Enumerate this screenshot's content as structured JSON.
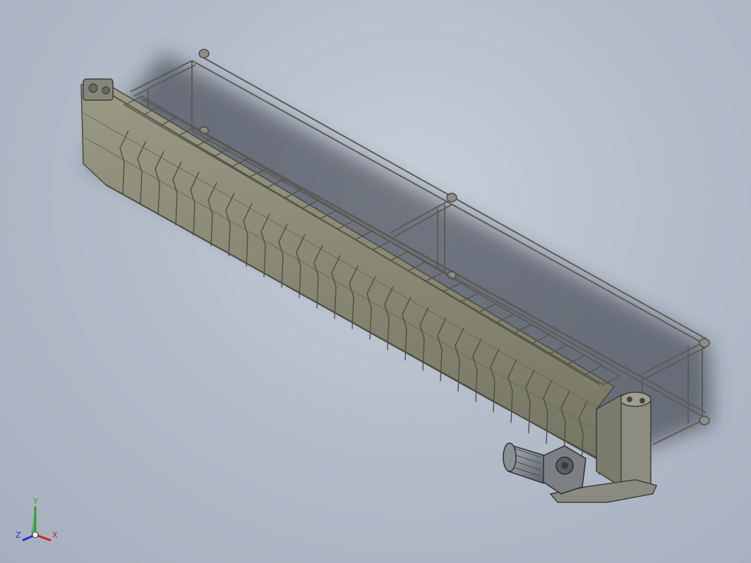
{
  "viewport": {
    "background_top": "#c6ced9",
    "background_bottom": "#a5afbd"
  },
  "model": {
    "frame_color": "#7a7a72",
    "trough_color": "#8a8a78",
    "trough_dark": "#6e6e60",
    "motor_color": "#8f9499"
  },
  "triad": {
    "x_label": "X",
    "y_label": "Y",
    "z_label": "Z",
    "x_color": "#d42020",
    "y_color": "#2fa02f",
    "z_color": "#2030d0"
  }
}
